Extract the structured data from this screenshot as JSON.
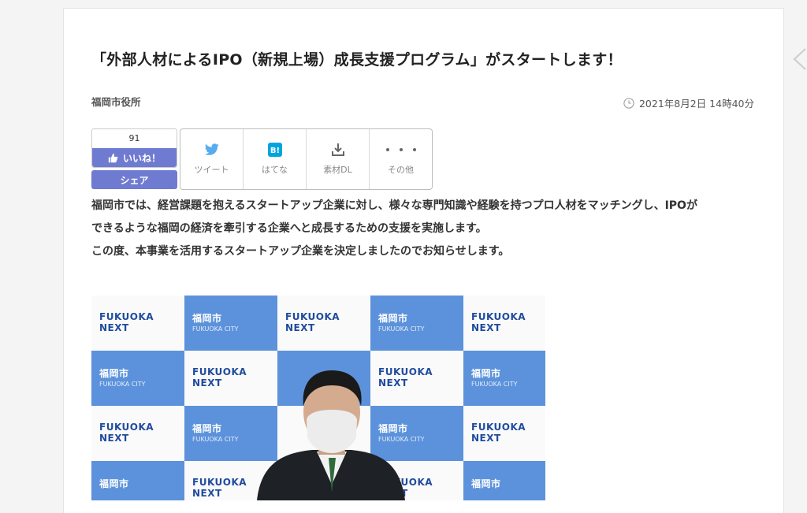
{
  "article": {
    "title": "「外部人材によるIPO（新規上場）成長支援プログラム」がスタートします！",
    "author": "福岡市役所",
    "date": "2021年8月2日 14時40分"
  },
  "reactions": {
    "like_count": "91",
    "like_label": "いいね！",
    "share_label": "シェア"
  },
  "share_bar": [
    {
      "icon": "twitter-bird-icon",
      "label": "ツイート"
    },
    {
      "icon": "hatena-bookmark-icon",
      "label": "はてな"
    },
    {
      "icon": "download-icon",
      "label": "素材DL"
    },
    {
      "icon": "more-dots-icon",
      "label": "その他"
    }
  ],
  "body": {
    "p1_line1": "福岡市では、経営課題を抱えるスタートアップ企業に対し、様々な専門知識や経験を持つプロ人材をマッチングし、IPOが",
    "p1_line2": "できるような福岡の経済を牽引する企業へと成長するための支援を実施します。",
    "p2": "この度、本事業を活用するスタートアップ企業を決定しましたのでお知らせします。"
  },
  "photo": {
    "logo_a": "FUKUOKA NEXT",
    "logo_b": "福岡市",
    "logo_b_sub": "FUKUOKA CITY"
  },
  "colors": {
    "accent": "#6f7bd1",
    "twitter": "#55acee",
    "hatena": "#00a4de",
    "backdrop_blue": "#5c92db"
  }
}
